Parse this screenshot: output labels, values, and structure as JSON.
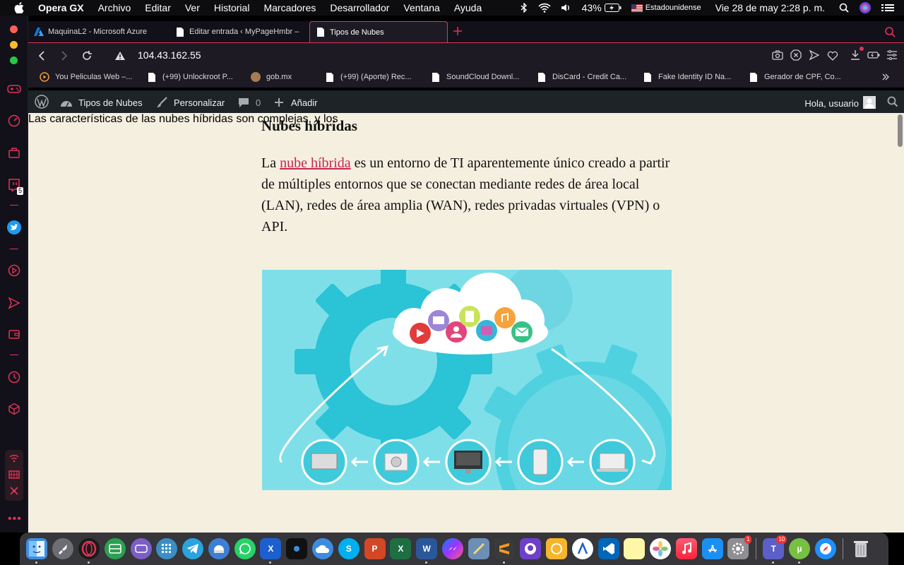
{
  "menubar": {
    "app_name": "Opera GX",
    "items": [
      "Archivo",
      "Editar",
      "Ver",
      "Historial",
      "Marcadores",
      "Desarrollador",
      "Ventana",
      "Ayuda"
    ],
    "battery": "43%",
    "keyboard": "Estadounidense",
    "datetime": "Vie 28 de may  2:28 p. m."
  },
  "sidebar": {
    "twitch_badge": "5"
  },
  "tabs": [
    {
      "label": "MaquinaL2 - Microsoft Azure",
      "icon": "azure-icon"
    },
    {
      "label": "Editar entrada ‹ MyPageHmbr –",
      "icon": "document-icon"
    },
    {
      "label": "Tipos de Nubes",
      "icon": "document-icon",
      "active": true
    }
  ],
  "address": {
    "url": "104.43.162.55"
  },
  "bookmarks": [
    {
      "label": "You Peliculas Web –...",
      "icon": "play-circle-icon"
    },
    {
      "label": "(+99) Unlockroot P...",
      "icon": "document-icon"
    },
    {
      "label": "gob.mx",
      "icon": "circle-icon"
    },
    {
      "label": "(+99) (Aporte) Rec...",
      "icon": "document-icon"
    },
    {
      "label": "SoundCloud Downl...",
      "icon": "document-icon"
    },
    {
      "label": "DisCard - Credit Ca...",
      "icon": "document-icon"
    },
    {
      "label": "Fake Identity ID Na...",
      "icon": "document-icon"
    },
    {
      "label": "Gerador de CPF, Co...",
      "icon": "document-icon"
    }
  ],
  "wpbar": {
    "site": "Tipos de Nubes",
    "customize": "Personalizar",
    "comments": "0",
    "add": "Añadir",
    "greeting": "Hola, usuario"
  },
  "article": {
    "heading": "Nubes híbridas",
    "p1_before": "La ",
    "p1_link": "nube híbrida",
    "p1_after": " es un entorno de TI aparentemente único creado a partir de múltiples entornos que se conectan mediante redes de área local (LAN), redes de área amplia (WAN), redes privadas virtuales (VPN) o API.",
    "p2_partial": "Las características de las nubes híbridas son complejas, y los"
  },
  "dock": {
    "teams_badge": "10",
    "prefs_badge": "1"
  },
  "colors": {
    "accent": "#e0345a",
    "page_bg": "#f5efe0",
    "link": "#c7254e",
    "figure_bg": "#7fdfe8"
  }
}
